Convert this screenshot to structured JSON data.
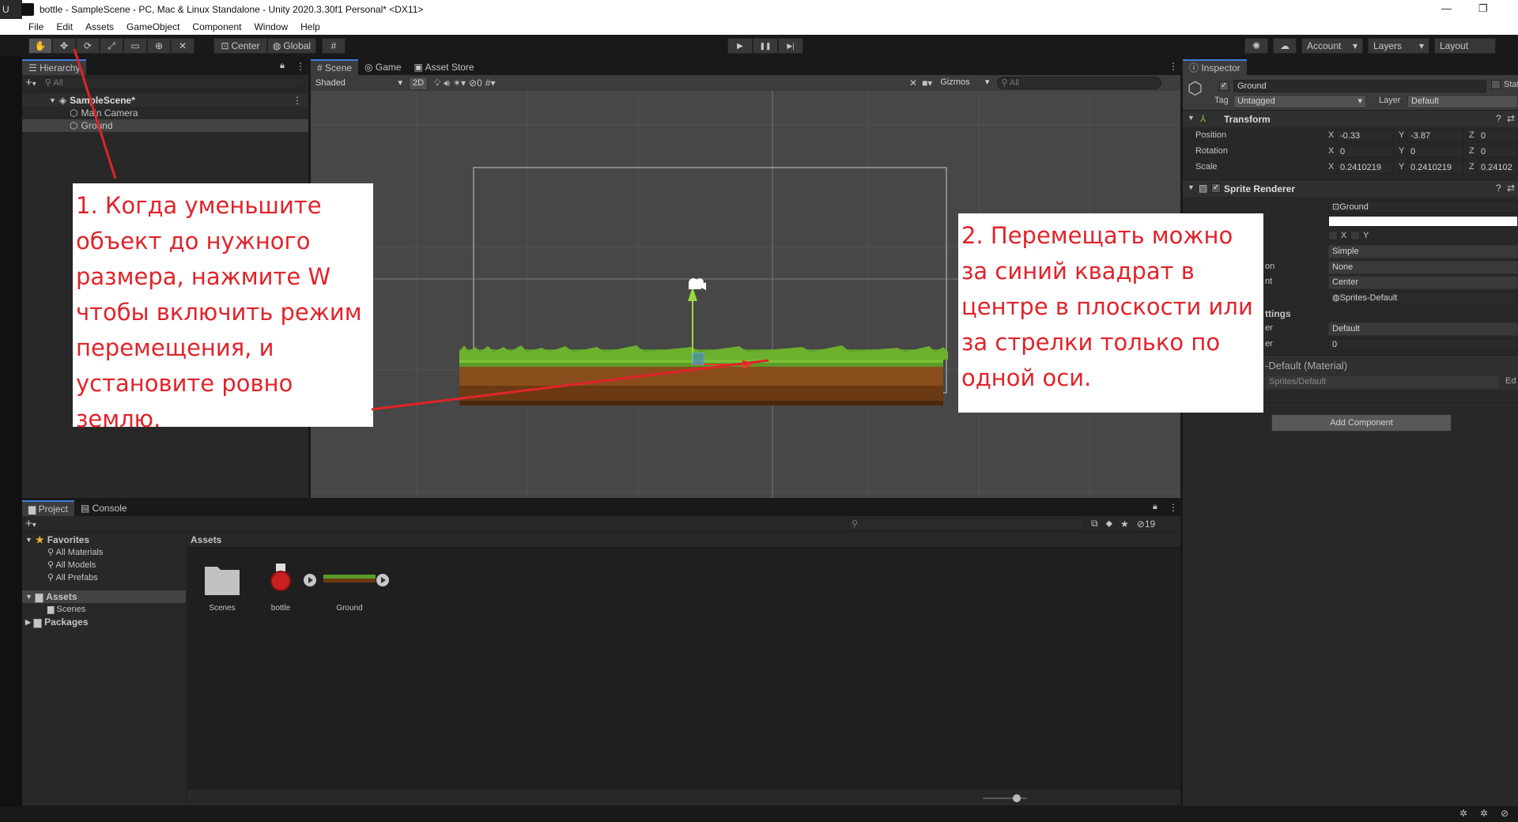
{
  "window": {
    "title": "bottle - SampleScene - PC, Mac & Linux Standalone - Unity 2020.3.30f1 Personal* <DX11>",
    "left_strip_label": "U",
    "minimize_glyph": "—",
    "restore_glyph": "❐"
  },
  "menu": [
    "File",
    "Edit",
    "Assets",
    "GameObject",
    "Component",
    "Window",
    "Help"
  ],
  "toolbar": {
    "tools": [
      "hand-icon",
      "move-icon",
      "rotate-icon",
      "scale-icon",
      "rect-icon",
      "transform-icon",
      "custom-tool-icon"
    ],
    "pivot": "Center",
    "space": "Global",
    "play_glyph": "▶",
    "pause_glyph": "❚❚",
    "step_glyph": "▶|",
    "account": "Account",
    "layers": "Layers",
    "layout": "Layout",
    "dropdown_glyph": "▾"
  },
  "hierarchy": {
    "tab": "Hierarchy",
    "add": "+",
    "add_caret": "▾",
    "search_placeholder": "All",
    "scene_name": "SampleScene*",
    "items": [
      "Main Camera",
      "Ground"
    ]
  },
  "scene_view": {
    "tabs": [
      "Scene",
      "Game",
      "Asset Store"
    ],
    "shading": "Shaded",
    "mode_2d": "2D",
    "hidden_count": "0",
    "gizmos": "Gizmos",
    "search_placeholder": "All"
  },
  "inspector": {
    "tab": "Inspector",
    "object_name": "Ground",
    "static_label": "Stat",
    "tag_label": "Tag",
    "tag_value": "Untagged",
    "layer_label": "Layer",
    "layer_value": "Default",
    "transform": {
      "title": "Transform",
      "position_label": "Position",
      "rotation_label": "Rotation",
      "scale_label": "Scale",
      "axis_labels": [
        "X",
        "Y",
        "Z"
      ],
      "position": [
        "-0.33",
        "-3.87",
        "0"
      ],
      "rotation": [
        "0",
        "0",
        "0"
      ],
      "scale": [
        "0.2410219",
        "0.2410219",
        "0.24102"
      ]
    },
    "sprite_renderer": {
      "title": "Sprite Renderer",
      "sprite": "Ground",
      "flip_x": "X",
      "flip_y": "Y",
      "draw_mode": "Simple",
      "mask_partial": "on",
      "mask_interaction": "None",
      "sort_point_partial": "nt",
      "sort_point": "Center",
      "material": "Sprites-Default",
      "additional_settings_partial": "ttings",
      "sorting_layer_partial": "er",
      "sorting_layer": "Default",
      "order_partial": "er",
      "order_in_layer": "0"
    },
    "material_header": "-Default (Material)",
    "shader_label": "Sprites/Default",
    "edit_partial": "Ed",
    "add_component": "Add Component"
  },
  "project": {
    "tabs": [
      "Project",
      "Console"
    ],
    "add": "+",
    "add_caret": "▾",
    "favorites_label": "Favorites",
    "favorites": [
      "All Materials",
      "All Models",
      "All Prefabs"
    ],
    "assets_label": "Assets",
    "assets_children": [
      "Scenes"
    ],
    "packages_label": "Packages",
    "breadcrumb": "Assets",
    "hidden_count": "19",
    "items": [
      "Scenes",
      "bottle",
      "Ground"
    ]
  },
  "annotations": {
    "note1": "1. Когда уменьшите объект до нужного размера, нажмите W чтобы включить режим перемещения, и установите ровно землю.",
    "note2": "2. Перемещать можно за синий квадрат в центре в плоскости или за стрелки только по одной оси."
  },
  "colors": {
    "accent": "#3d7fd9",
    "annotation_red": "#e0242a",
    "grass": "#5a9c28",
    "dirt": "#6b3a12",
    "arrow_green": "#9bd840",
    "arrow_red": "#e0402a"
  }
}
